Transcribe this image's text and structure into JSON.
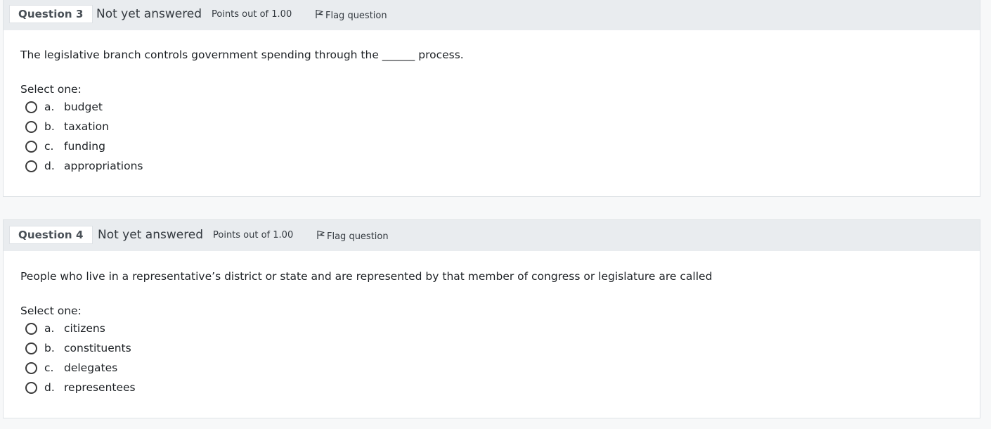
{
  "questions": [
    {
      "number_label": "Question 3",
      "state": "Not yet answered",
      "grade": "Points out of 1.00",
      "flag_label": "Flag question",
      "text": "The legislative branch controls government spending through the ______ process.",
      "prompt": "Select one:",
      "options": [
        {
          "letter": "a.",
          "label": "budget"
        },
        {
          "letter": "b.",
          "label": "taxation"
        },
        {
          "letter": "c.",
          "label": "funding"
        },
        {
          "letter": "d.",
          "label": "appropriations"
        }
      ]
    },
    {
      "number_label": "Question 4",
      "state": "Not yet answered",
      "grade": "Points out of 1.00",
      "flag_label": "Flag question",
      "text": "People who live in a representative’s district or state and are represented by that member of congress or legislature are called",
      "prompt": "Select one:",
      "options": [
        {
          "letter": "a.",
          "label": "citizens"
        },
        {
          "letter": "b.",
          "label": "constituents"
        },
        {
          "letter": "c.",
          "label": "delegates"
        },
        {
          "letter": "d.",
          "label": "representees"
        }
      ]
    }
  ]
}
